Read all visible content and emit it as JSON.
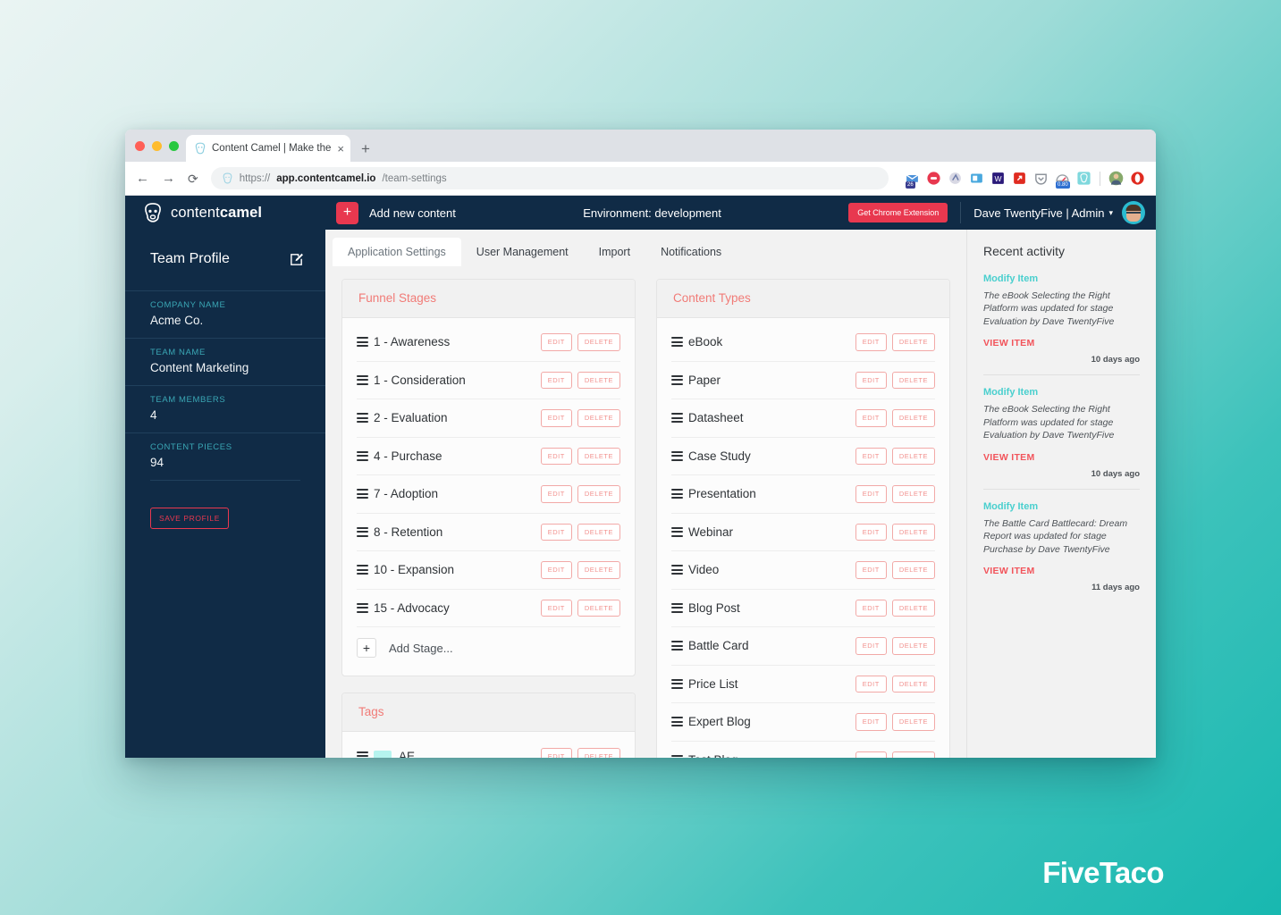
{
  "browser": {
    "tab_title": "Content Camel | Make the mos",
    "tab_close": "×",
    "new_tab": "+",
    "back": "←",
    "forward": "→",
    "reload": "⟳",
    "url_scheme": "https://",
    "url_host": "app.contentcamel.io",
    "url_path": "/team-settings",
    "extension_badges": {
      "mail_count": "26",
      "speed": "0.80"
    }
  },
  "appbar": {
    "brand_light": "content",
    "brand_bold": "camel",
    "add_plus": "+",
    "add_label": "Add new content",
    "environment": "Environment: development",
    "chrome_extension_label": "Get Chrome Extension",
    "user_name": "Dave TwentyFive | Admin",
    "caret": "▾"
  },
  "sidebar": {
    "title": "Team Profile",
    "fields": [
      {
        "label": "COMPANY NAME",
        "value": "Acme Co."
      },
      {
        "label": "TEAM NAME",
        "value": "Content Marketing"
      },
      {
        "label": "TEAM MEMBERS",
        "value": "4"
      },
      {
        "label": "CONTENT PIECES",
        "value": "94"
      }
    ],
    "save_label": "SAVE PROFILE"
  },
  "tabs": [
    {
      "label": "Application Settings",
      "active": true
    },
    {
      "label": "User Management",
      "active": false
    },
    {
      "label": "Import",
      "active": false
    },
    {
      "label": "Notifications",
      "active": false
    }
  ],
  "buttons": {
    "edit": "EDIT",
    "delete": "DELETE"
  },
  "funnel_stages": {
    "title": "Funnel Stages",
    "items": [
      "1 - Awareness",
      "1 - Consideration",
      "2 - Evaluation",
      "4 - Purchase",
      "7 - Adoption",
      "8 - Retention",
      "10 - Expansion",
      "15 - Advocacy"
    ],
    "add_label": "Add Stage...",
    "add_plus": "+"
  },
  "tags": {
    "title": "Tags",
    "items": [
      {
        "label": "AE",
        "color": "#b6f4ef"
      }
    ]
  },
  "content_types": {
    "title": "Content Types",
    "items": [
      "eBook",
      "Paper",
      "Datasheet",
      "Case Study",
      "Presentation",
      "Webinar",
      "Video",
      "Blog Post",
      "Battle Card",
      "Price List",
      "Expert Blog",
      "Test Blog"
    ]
  },
  "activity": {
    "title": "Recent activity",
    "view_label": "VIEW ITEM",
    "items": [
      {
        "type": "Modify Item",
        "description": "The eBook Selecting the Right Platform was updated for stage Evaluation by Dave TwentyFive",
        "time": "10 days ago"
      },
      {
        "type": "Modify Item",
        "description": "The eBook Selecting the Right Platform was updated for stage Evaluation by Dave TwentyFive",
        "time": "10 days ago"
      },
      {
        "type": "Modify Item",
        "description": "The Battle Card Battlecard: Dream Report was updated for stage Purchase by Dave TwentyFive",
        "time": "11 days ago"
      }
    ]
  },
  "watermark": "FiveTaco",
  "colors": {
    "navy": "#102b46",
    "accent_red": "#e8384f",
    "salmon": "#f17b77",
    "teal": "#49cfce",
    "sidebar_label": "#3aa7b5"
  }
}
